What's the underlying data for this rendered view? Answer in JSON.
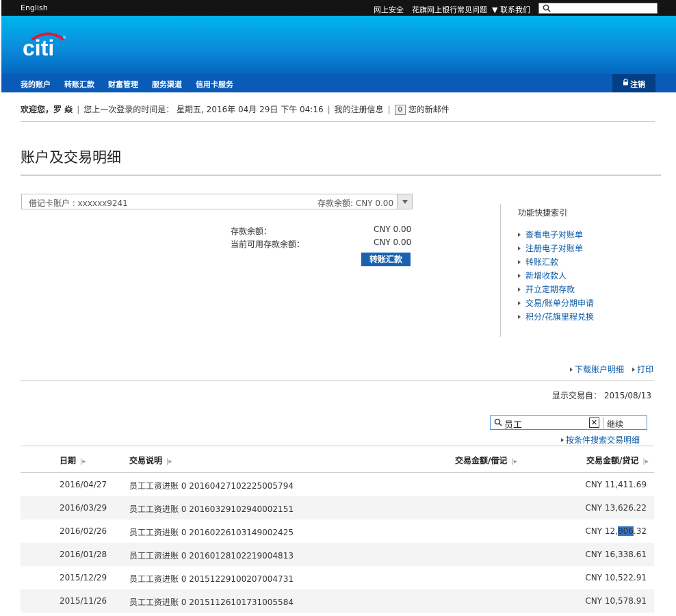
{
  "topbar": {
    "language": "English",
    "links": [
      "网上安全",
      "花旗网上银行常见问题",
      "▼ 联系我们"
    ],
    "search_placeholder": ""
  },
  "brand": {
    "logo_text": "citi",
    "color": "#003b70",
    "arc_color": "#e31837"
  },
  "nav": {
    "items": [
      "我的账户",
      "转账汇款",
      "财富管理",
      "服务渠道",
      "信用卡服务"
    ],
    "logout": "注销"
  },
  "welcome": {
    "greeting": "欢迎您，罗 焱",
    "last_login": "您上一次登录的时间是： 星期五, 2016年 04月 29日 下午 04:16",
    "my_info": "我的注册信息",
    "mail_count": "0",
    "new_mail": "您的新邮件"
  },
  "page_title": "账户及交易明细",
  "account": {
    "selector": "借记卡账户 : xxxxxx9241",
    "selector_balance": "存款余额: CNY 0.00",
    "balance_label": "存款余额：",
    "balance_value": "CNY 0.00",
    "available_label": "当前可用存款余额：",
    "available_value": "CNY 0.00",
    "transfer_button": "转账汇款"
  },
  "quick": {
    "title": "功能快捷索引",
    "links": [
      "查看电子对账单",
      "注册电子对账单",
      "转账汇款",
      "新增收款人",
      "开立定期存款",
      "交易/账单分期申请",
      "积分/花旗里程兑换"
    ]
  },
  "actions": {
    "download": "下载账户明细",
    "print": "打印"
  },
  "show_from": {
    "label": "显示交易自：",
    "date": "2015/08/13"
  },
  "filter": {
    "value": "员工",
    "clear": "✕",
    "go": "继续"
  },
  "condition_search": "按条件搜索交易明细",
  "table": {
    "headers": {
      "date": "日期",
      "desc": "交易说明",
      "debit": "交易金额/借记",
      "credit": "交易金额/贷记"
    },
    "rows": [
      {
        "date": "2016/04/27",
        "desc": "员工工资进账 0 20160427102225005794",
        "amount": "CNY 11,411.69"
      },
      {
        "date": "2016/03/29",
        "desc": "员工工资进账 0 20160329102940002151",
        "amount": "CNY 13,626.22"
      },
      {
        "date": "2016/02/26",
        "desc": "员工工资进账 0 20160226103149002425",
        "amount_pre": "CNY 12,",
        "amount_hl": "806",
        "amount_post": ".32"
      },
      {
        "date": "2016/01/28",
        "desc": "员工工资进账 0 20160128102219004813",
        "amount": "CNY 16,338.61"
      },
      {
        "date": "2015/12/29",
        "desc": "员工工资进账 0 20151229100207004731",
        "amount": "CNY 10,522.91"
      },
      {
        "date": "2015/11/26",
        "desc": "员工工资进账 0 20151126101731005584",
        "amount": "CNY 10,578.91"
      }
    ]
  }
}
